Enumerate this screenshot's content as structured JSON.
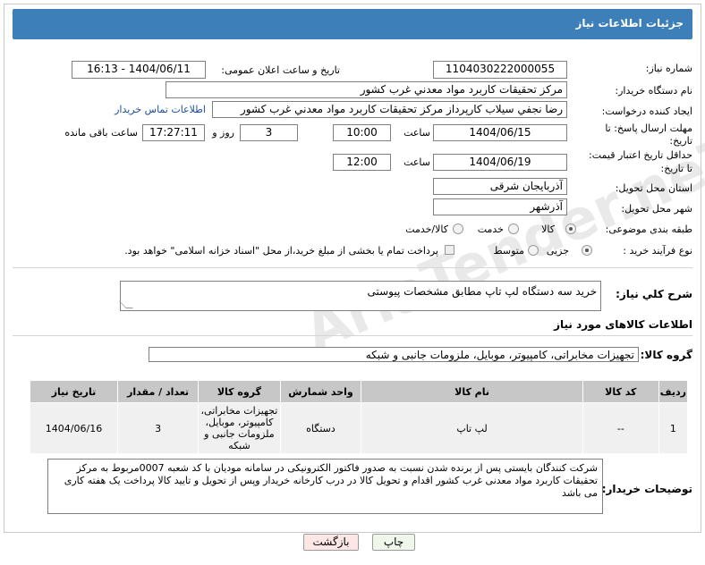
{
  "page_title": "جزئیات اطلاعات نیاز",
  "fields": {
    "need_number_label": "شماره نیاز:",
    "need_number": "1104030222000055",
    "announce_label": "تاریخ و ساعت اعلان عمومی:",
    "announce_value": "1404/06/11 - 16:13",
    "buyer_org_label": "نام دستگاه خریدار:",
    "buyer_org": "مرکز تحقیقات کاربرد مواد معدني غرب کشور",
    "requester_label": "ایجاد کننده درخواست:",
    "requester": "رضا نجفي سيلاب کارپرداز مرکز تحقیقات کاربرد مواد معدني غرب کشور",
    "contact_link": "اطلاعات تماس خریدار",
    "deadline_label_1": "مهلت ارسال پاسخ: تا",
    "deadline_label_2": "تاریخ:",
    "deadline_date": "1404/06/15",
    "time_label": "ساعت",
    "deadline_time": "10:00",
    "days_value": "3",
    "days_label": "روز و",
    "remaining_time": "17:27:11",
    "remaining_label": "ساعت باقی مانده",
    "price_label_1": "حداقل تاریخ اعتبار قیمت:",
    "price_label_2": "تا تاریخ:",
    "price_date": "1404/06/19",
    "price_time": "12:00",
    "province_label": "استان محل تحویل:",
    "province": "آذربایجان شرقی",
    "city_label": "شهر محل تحویل:",
    "city": "آذرشهر",
    "category_label": "طبقه بندی موضوعی:",
    "category_options": [
      "کالا",
      "خدمت",
      "کالا/خدمت"
    ],
    "process_label": "نوع فرآیند خرید :",
    "process_options": [
      "جزیی",
      "متوسط"
    ],
    "payment_text": "پرداخت تمام یا بخشی از مبلغ خرید،از محل \"اسناد خزانه اسلامی\" خواهد بود.",
    "description_label": "شرح کلي نياز:",
    "description": "خرید سه دستگاه لپ تاپ مطابق مشخصات پیوستی"
  },
  "goods_section_title": "اطلاعات کالاهای مورد نیاز",
  "goods_group_label": "گروه کالا:",
  "goods_group": "تجهیزات مخابراتی، کامپیوتر، موبایل، ملزومات جانبی و شبکه",
  "table": {
    "headers": [
      "ردیف",
      "کد کالا",
      "نام کالا",
      "واحد شمارش",
      "گروه کالا",
      "تعداد / مقدار",
      "تاریخ نیاز"
    ],
    "rows": [
      {
        "row": "1",
        "code": "--",
        "name": "لپ تاپ",
        "unit": "دستگاه",
        "group": "تجهیزات مخابراتی، کامپیوتر، موبایل، ملزومات جانبی و شبکه",
        "qty": "3",
        "date": "1404/06/16"
      }
    ]
  },
  "buyer_notes_label": "توضیحات خریدار:",
  "buyer_notes": "شرکت کنندگان بایستی پس از برنده شدن نسبت به صدور فاکتور الکترونیکی در سامانه مودیان با کد شعبه 0007مربوط به مرکز تحقیقات کاربرد مواد معدنی غرب کشور اقدام و تحویل کالا در درب کارخانه خریدار  وپس از تحویل و تایید کالا پرداخت یک هفته کاری می باشد",
  "buttons": {
    "print": "چاپ",
    "back": "بازگشت"
  },
  "watermark_text": "AriaTender.neT",
  "colors": {
    "title_bg": "#3d7fb8",
    "link": "#1a4fa0",
    "back_button_bg": "#fde6e6",
    "print_button_bg": "#eef7ea"
  }
}
